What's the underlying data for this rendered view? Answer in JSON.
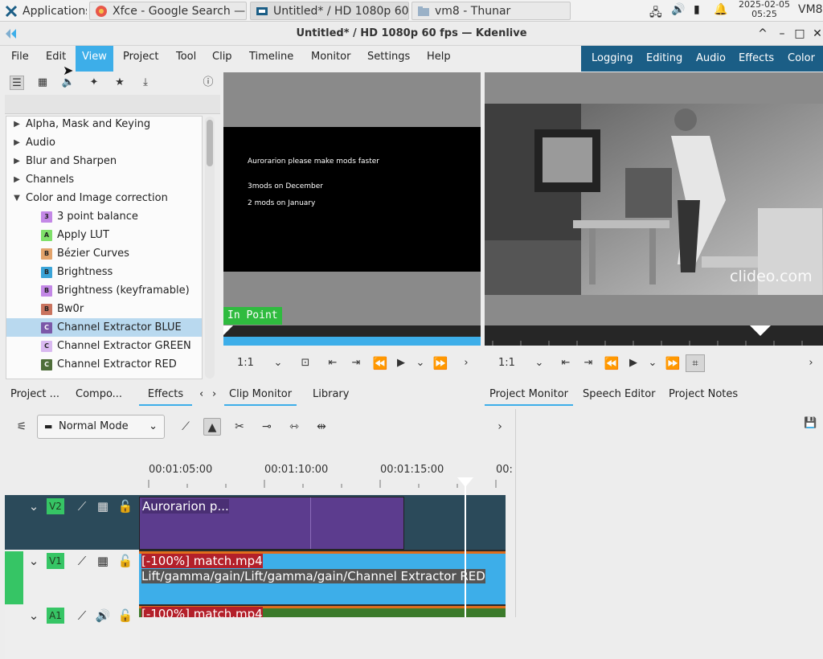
{
  "taskbar": {
    "apps": "Applications",
    "tasks": [
      {
        "label": "Xfce - Google Search — ...",
        "color": "#e8574a"
      },
      {
        "label": "Untitled* / HD 1080p 60...",
        "color": "#1b5e86"
      },
      {
        "label": "vm8 - Thunar",
        "color": "#9ab1c7"
      }
    ],
    "date": "2025-02-05",
    "time": "05:25",
    "host": "VM8"
  },
  "window": {
    "title": "Untitled* / HD 1080p 60 fps — Kdenlive",
    "controls": [
      "^",
      "–",
      "□",
      "✕"
    ]
  },
  "menu": {
    "items": [
      "File",
      "Edit",
      "View",
      "Project",
      "Tool",
      "Clip",
      "Timeline",
      "Monitor",
      "Settings",
      "Help"
    ],
    "active_index": 2
  },
  "layouts": [
    "Logging",
    "Editing",
    "Audio",
    "Effects",
    "Color"
  ],
  "effects_panel": {
    "categories": [
      {
        "label": "Alpha, Mask and Keying",
        "expanded": false
      },
      {
        "label": "Audio",
        "expanded": false
      },
      {
        "label": "Blur and Sharpen",
        "expanded": false
      },
      {
        "label": "Channels",
        "expanded": false
      },
      {
        "label": "Color and Image correction",
        "expanded": true
      }
    ],
    "effects": [
      {
        "badge": "3",
        "label": "3 point balance",
        "color": "#c388e6"
      },
      {
        "badge": "A",
        "label": "Apply LUT",
        "color": "#7fe06a"
      },
      {
        "badge": "B",
        "label": "Bézier Curves",
        "color": "#e2a36b"
      },
      {
        "badge": "B",
        "label": "Brightness",
        "color": "#3aa4d8"
      },
      {
        "badge": "B",
        "label": "Brightness (keyframable)",
        "color": "#c388e6"
      },
      {
        "badge": "B",
        "label": "Bw0r",
        "color": "#c9735e"
      },
      {
        "badge": "C",
        "label": "Channel Extractor BLUE",
        "color": "#7b58a8"
      },
      {
        "badge": "C",
        "label": "Channel Extractor GREEN",
        "color": "#d9b9f0"
      },
      {
        "badge": "C",
        "label": "Channel Extractor RED",
        "color": "#4f6e3a"
      }
    ],
    "selected_index": 6
  },
  "clip_monitor": {
    "lines": [
      "Aurorarion please make mods faster",
      "3mods on December",
      "2 mods on January"
    ],
    "in_point": "In Point",
    "zoom": "1:1"
  },
  "project_monitor": {
    "watermark": "clideo.com",
    "zoom": "1:1"
  },
  "tabs_left": [
    "Project ...",
    "Compo...",
    "Effects"
  ],
  "tabs_left_active": 2,
  "tabs_middle": [
    "Clip Monitor",
    "Library"
  ],
  "tabs_right": [
    "Project Monitor",
    "Speech Editor",
    "Project Notes"
  ],
  "timeline": {
    "mode": "Normal Mode",
    "ruler": [
      "00:01:05:00",
      "00:01:10:00",
      "00:01:15:00",
      "00:"
    ],
    "tracks": [
      "V2",
      "V1",
      "A1"
    ],
    "clip_v2": "Aurorarion p...",
    "clip_v1_title": "[-100%] match.mp4",
    "clip_v1_effects": "Lift/gamma/gain/Lift/gamma/gain/Channel Extractor RED",
    "clip_a1": "[-100%] match.mp4"
  },
  "colors": {
    "accent": "#3daee9",
    "layout_bar": "#1b5e86",
    "track_green": "#36c565",
    "in_point_green": "#2fbb3f"
  }
}
